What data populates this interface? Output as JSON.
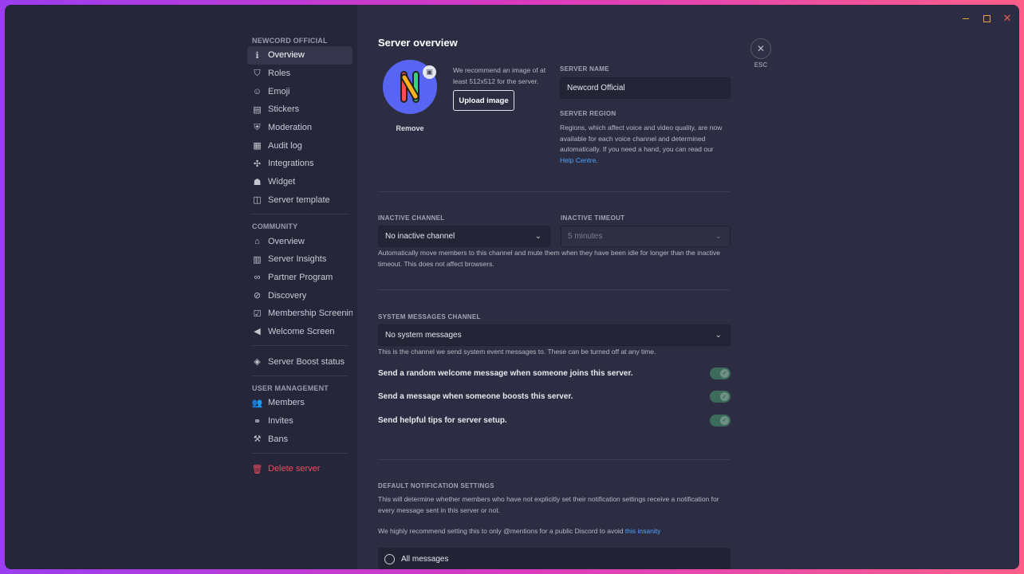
{
  "sidebar": {
    "section_server": "NEWCORD OFFICIAL",
    "server_items": [
      {
        "label": "Overview",
        "icon": "info-icon",
        "glyph": "ℹ",
        "active": true
      },
      {
        "label": "Roles",
        "icon": "shield-user-icon",
        "glyph": "⛉"
      },
      {
        "label": "Emoji",
        "icon": "emoji-icon",
        "glyph": "☺"
      },
      {
        "label": "Stickers",
        "icon": "sticker-icon",
        "glyph": "▤"
      },
      {
        "label": "Moderation",
        "icon": "moderation-shield-icon",
        "glyph": "⛨"
      },
      {
        "label": "Audit log",
        "icon": "clipboard-icon",
        "glyph": "▦"
      },
      {
        "label": "Integrations",
        "icon": "gamepad-icon",
        "glyph": "✣"
      },
      {
        "label": "Widget",
        "icon": "robot-icon",
        "glyph": "☗"
      },
      {
        "label": "Server template",
        "icon": "template-icon",
        "glyph": "◫"
      }
    ],
    "section_community": "COMMUNITY",
    "community_items": [
      {
        "label": "Overview",
        "icon": "community-icon",
        "glyph": "⌂"
      },
      {
        "label": "Server Insights",
        "icon": "insights-icon",
        "glyph": "▥"
      },
      {
        "label": "Partner Program",
        "icon": "partner-icon",
        "glyph": "∞"
      },
      {
        "label": "Discovery",
        "icon": "compass-icon",
        "glyph": "⊘"
      },
      {
        "label": "Membership Screening",
        "icon": "checkbox-icon",
        "glyph": "☑"
      },
      {
        "label": "Welcome Screen",
        "icon": "megaphone-icon",
        "glyph": "◀"
      }
    ],
    "boost_item": {
      "label": "Server Boost status",
      "icon": "boost-gem-icon",
      "glyph": "◈"
    },
    "section_user": "USER MANAGEMENT",
    "user_items": [
      {
        "label": "Members",
        "icon": "members-icon",
        "glyph": "👥"
      },
      {
        "label": "Invites",
        "icon": "link-icon",
        "glyph": "⚭"
      },
      {
        "label": "Bans",
        "icon": "hammer-icon",
        "glyph": "⚒"
      }
    ],
    "delete_item": {
      "label": "Delete server",
      "icon": "trash-icon",
      "glyph": "🗑"
    }
  },
  "main": {
    "title": "Server overview",
    "icon_hint": "We recommend an image of at least 512x512 for the server.",
    "upload_label": "Upload image",
    "remove_label": "Remove",
    "server_name_label": "SERVER NAME",
    "server_name_value": "Newcord Official",
    "server_region_label": "SERVER REGION",
    "server_region_text": "Regions, which affect voice and video quality, are now available for each voice channel and determined automatically. If you need a hand, you can read our",
    "help_link": "Help Centre",
    "inactive_channel_label": "INACTIVE CHANNEL",
    "inactive_channel_value": "No inactive channel",
    "inactive_timeout_label": "INACTIVE TIMEOUT",
    "inactive_timeout_value": "5 minutes",
    "inactive_help": "Automatically move members to this channel and mute them when they have been idle for longer than the inactive timeout. This does not affect browsers.",
    "system_channel_label": "SYSTEM MESSAGES CHANNEL",
    "system_channel_value": "No system messages",
    "system_channel_help": "This is the channel we send system event messages to. These can be turned off at any time.",
    "toggles": [
      {
        "label": "Send a random welcome message when someone joins this server.",
        "on": true
      },
      {
        "label": "Send a message when someone boosts this server.",
        "on": true
      },
      {
        "label": "Send helpful tips for server setup.",
        "on": true
      }
    ],
    "notif_label": "DEFAULT NOTIFICATION SETTINGS",
    "notif_help": "This will determine whether members who have not explicitly set their notification settings receive a notification for every message sent in this server or not.",
    "notif_recommend": "We highly recommend setting this to only @mentions for a public Discord to avoid",
    "notif_link": "this insanity",
    "notif_option": "All messages"
  },
  "close": {
    "esc_label": "ESC"
  },
  "colors": {
    "accent": "#5865f2",
    "link": "#4fa3ff",
    "danger": "#f04c5b",
    "toggle_on": "#3c6b5c"
  }
}
